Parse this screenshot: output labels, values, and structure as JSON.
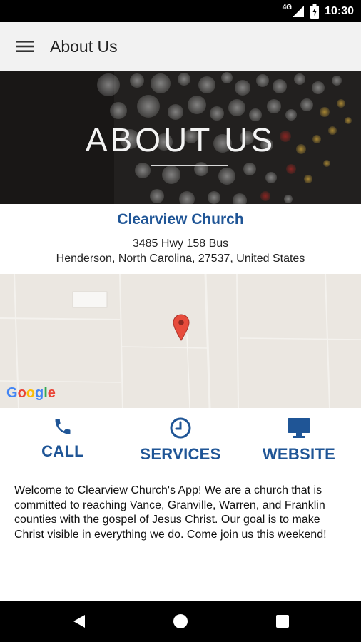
{
  "status_bar": {
    "network": "4G",
    "time": "10:30"
  },
  "app_bar": {
    "title": "About Us",
    "menu_icon": "hamburger-menu-icon"
  },
  "hero": {
    "title": "ABOUT US"
  },
  "church": {
    "name": "Clearview Church",
    "address_line1": "3485 Hwy 158 Bus",
    "address_line2": "Henderson, North Carolina, 27537, United States"
  },
  "map": {
    "attribution": "Google",
    "pin_icon": "map-pin-icon"
  },
  "actions": [
    {
      "label": "CALL",
      "icon": "phone-icon"
    },
    {
      "label": "SERVICES",
      "icon": "clock-icon"
    },
    {
      "label": "WEBSITE",
      "icon": "monitor-icon"
    }
  ],
  "description": "Welcome to Clearview Church's App! We are a church that is committed to reaching Vance, Granville, Warren, and Franklin counties with the gospel of Jesus Christ. Our goal is to make Christ visible in everything we do. Come join us this weekend!",
  "colors": {
    "brand_blue": "#1f5596",
    "app_bar": "#f2f2f2",
    "map_bg": "#ebe7e1",
    "pin_red": "#e74c3c"
  },
  "nav_bar": {
    "back_icon": "back-triangle-icon",
    "home_icon": "home-circle-icon",
    "recents_icon": "recents-square-icon"
  }
}
